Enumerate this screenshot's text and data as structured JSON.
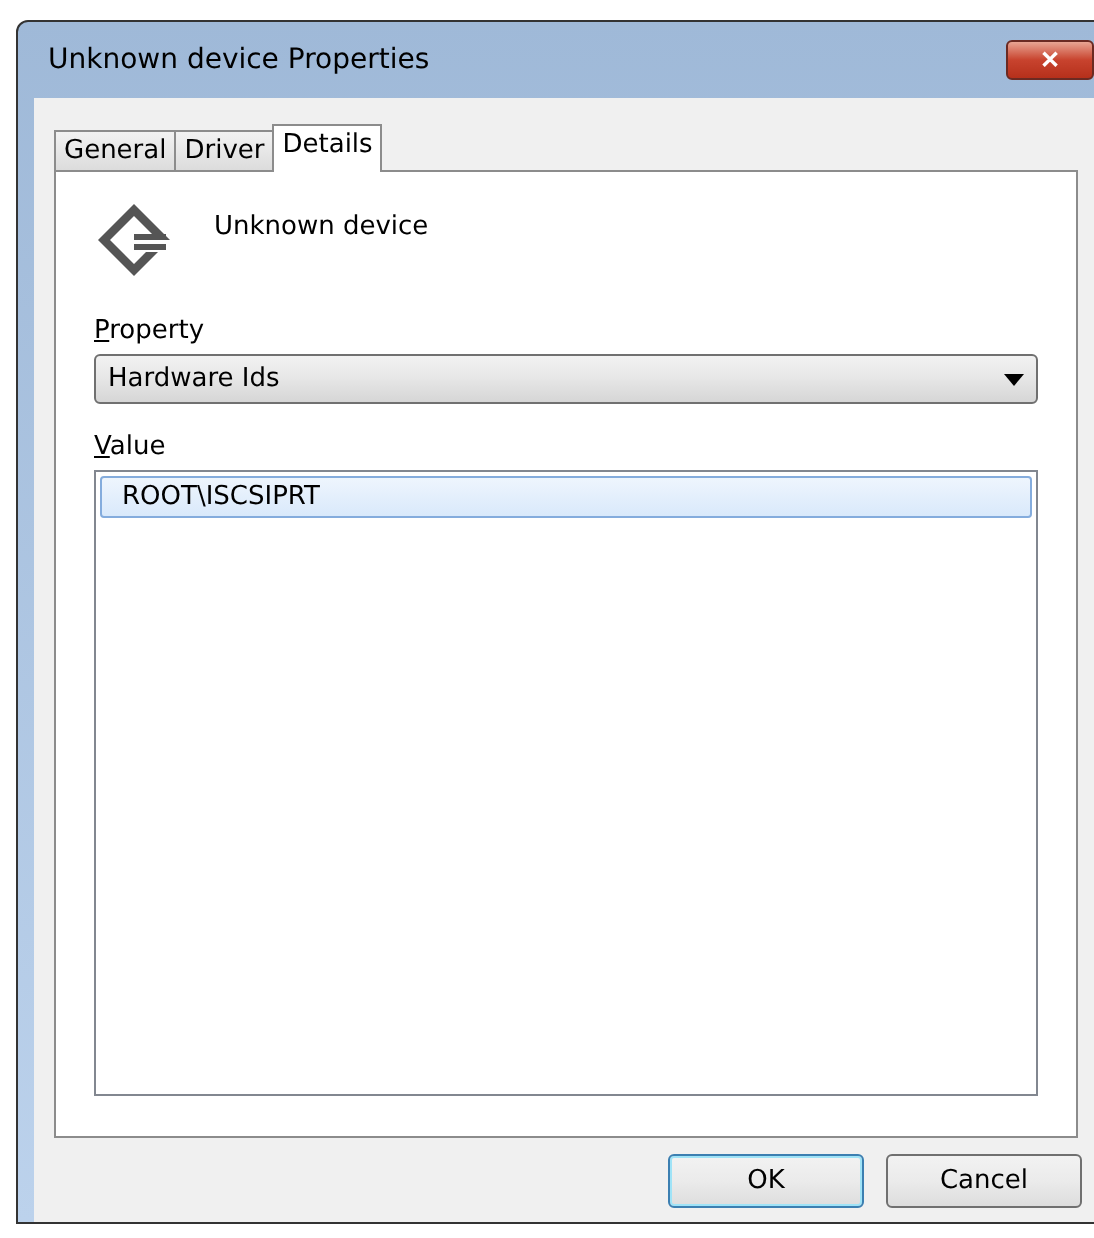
{
  "window": {
    "title": "Unknown device Properties",
    "close": "✕"
  },
  "tabs": [
    {
      "label": "General",
      "selected": false
    },
    {
      "label": "Driver",
      "selected": false
    },
    {
      "label": "Details",
      "selected": true
    }
  ],
  "device": {
    "name": "Unknown device"
  },
  "property": {
    "label": "Property",
    "value": "Hardware Ids"
  },
  "value": {
    "label": "Value",
    "items": [
      {
        "text": "ROOT\\ISCSIPRT",
        "selected": true
      }
    ]
  },
  "buttons": [
    {
      "label": "OK",
      "kind": "default"
    },
    {
      "label": "Cancel",
      "kind": "normal"
    }
  ]
}
